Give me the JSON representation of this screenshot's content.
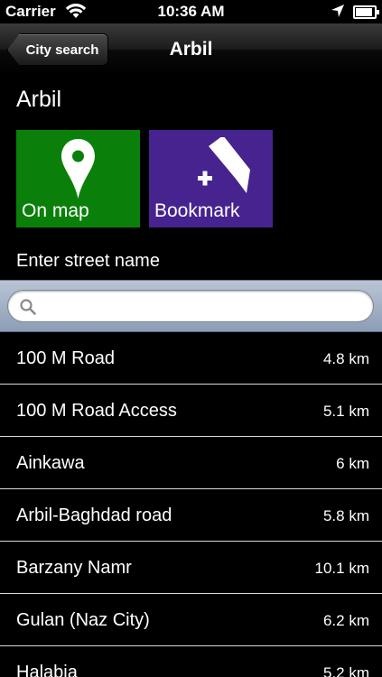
{
  "status_bar": {
    "carrier": "Carrier",
    "time": "10:36 AM"
  },
  "nav": {
    "back_label": "City search",
    "title": "Arbil"
  },
  "city": {
    "name": "Arbil"
  },
  "actions": {
    "on_map": {
      "label": "On map",
      "color": "#0a800a",
      "icon": "map-pin-icon"
    },
    "bookmark": {
      "label": "Bookmark",
      "color": "#47238f",
      "icon": "bookmark-add-icon"
    }
  },
  "street": {
    "prompt": "Enter street name",
    "search_value": "",
    "search_placeholder": ""
  },
  "streets": [
    {
      "name": "100 M Road",
      "distance": "4.8 km"
    },
    {
      "name": "100 M Road Access",
      "distance": "5.1 km"
    },
    {
      "name": "Ainkawa",
      "distance": "6 km"
    },
    {
      "name": "Arbil-Baghdad road",
      "distance": "5.8 km"
    },
    {
      "name": "Barzany Namr",
      "distance": "10.1 km"
    },
    {
      "name": "Gulan (Naz City)",
      "distance": "6.2 km"
    },
    {
      "name": "Halabja",
      "distance": "5.2 km"
    }
  ]
}
